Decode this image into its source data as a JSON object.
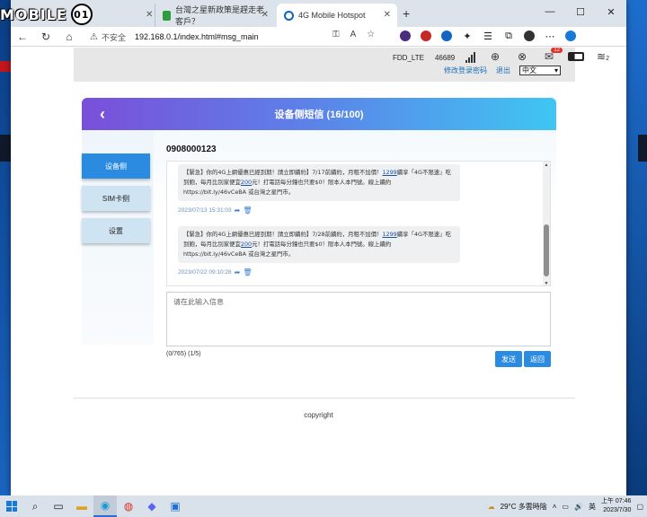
{
  "desktop": {
    "accent": "#1e6fd1"
  },
  "browser": {
    "brand": {
      "text": "MOBILE",
      "emblem": "01"
    },
    "tabs": [
      {
        "label": "台灣之星新政策是趕走老客戶？",
        "icon": "green-favicon"
      },
      {
        "label": "4G Mobile Hotspot",
        "icon": "globe-favicon"
      }
    ],
    "new_tab": "+",
    "window_controls": {
      "minimize": "—",
      "maximize": "☐",
      "close": "✕"
    },
    "nav": {
      "back": "←",
      "refresh": "↻",
      "home": "⌂"
    },
    "address": {
      "warning_label": "不安全",
      "url": "192.168.0.1/index.html#msg_main"
    }
  },
  "status": {
    "network_type": "FDD_LTE",
    "operator_code": "46689",
    "mail_badge": "12",
    "wifi_clients": "2",
    "links": {
      "change_password": "修改登录密码",
      "logout": "退出"
    },
    "language": "中文"
  },
  "sms": {
    "title": "设备侧短信 (16/100)",
    "sidebar": [
      {
        "label": "设备侧",
        "active": true
      },
      {
        "label": "SIM卡侧",
        "active": false
      },
      {
        "label": "设置",
        "active": false
      }
    ],
    "contact_number": "0908000123",
    "messages": [
      {
        "text_before": "【緊急】你的4G上網優惠已經到期！請立即續約】7/17前續約，月租不加價！",
        "link1": "1299",
        "text_mid": "吃到飽，每月比別家便宜",
        "link2": "200",
        "text_after": "元！打電話每分鐘也只要$0！限本人本門號。線上續約 https://bit.ly/46vCeBA 或台灣之星門市。",
        "tail": "續享「4G不限速」",
        "time": "2023/07/13 15:31:03"
      },
      {
        "text_before": "【緊急】你的4G上網優惠已經到期！請立即續約】7/28前續約，月租不加價！",
        "link1": "1299",
        "text_mid": "吃到飽，每月比別家便宜",
        "link2": "200",
        "text_after": "元！打電話每分鐘也只要$0！限本人本門號。線上續約 https://bit.ly/46vCeBA 或台灣之星門市。",
        "tail": "續享「4G不限速」",
        "time": "2023/07/22 09:10:28"
      }
    ],
    "input_placeholder": "请在此输入信息",
    "counter": "(0/765) (1/5)",
    "send_label": "发送",
    "return_label": "返回"
  },
  "footer": {
    "copyright": "copyright"
  },
  "taskbar": {
    "weather": "29°C  多雲時陰",
    "lang": "英",
    "time": "07:46",
    "ampm": "上午",
    "date": "2023/7/30"
  }
}
